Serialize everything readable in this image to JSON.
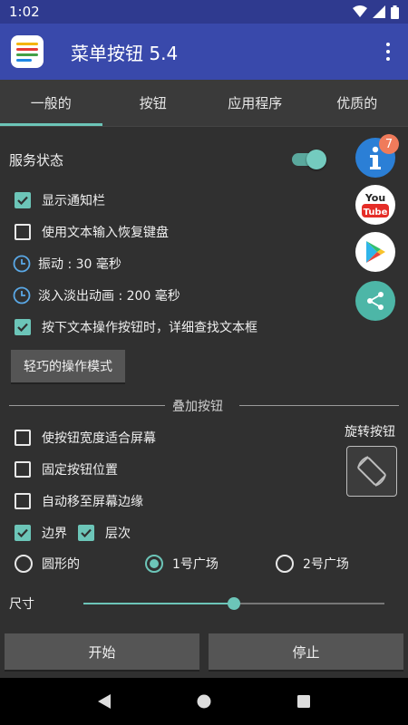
{
  "status_bar": {
    "time": "1:02"
  },
  "app_bar": {
    "title": "菜单按钮 5.4"
  },
  "tabs": [
    {
      "label": "一般的",
      "active": true
    },
    {
      "label": "按钮",
      "active": false
    },
    {
      "label": "应用程序",
      "active": false
    },
    {
      "label": "优质的",
      "active": false
    }
  ],
  "general": {
    "service_status_label": "服务状态",
    "service_enabled": true,
    "show_notification": {
      "label": "显示通知栏",
      "checked": true
    },
    "restore_keyboard": {
      "label": "使用文本输入恢复键盘",
      "checked": false
    },
    "vibration": {
      "label": "振动 : 30 毫秒"
    },
    "fade_animation": {
      "label": "淡入淡出动画 : 200 毫秒"
    },
    "find_textbox": {
      "label": "按下文本操作按钮时，详细查找文本框",
      "checked": true
    },
    "mode_button_label": "轻巧的操作模式"
  },
  "side_icons": {
    "info_badge": "7"
  },
  "overlay": {
    "section_title": "叠加按钮",
    "fit_width": {
      "label": "使按钮宽度适合屏幕",
      "checked": false
    },
    "fix_position": {
      "label": "固定按钮位置",
      "checked": false
    },
    "auto_edge": {
      "label": "自动移至屏幕边缘",
      "checked": false
    },
    "border": {
      "label": "边界",
      "checked": true
    },
    "shadow": {
      "label": "层次",
      "checked": true
    },
    "rotate_label": "旋转按钮",
    "shape_options": [
      {
        "label": "圆形的",
        "selected": false
      },
      {
        "label": "1号广场",
        "selected": true
      },
      {
        "label": "2号广场",
        "selected": false
      }
    ],
    "size_label": "尺寸",
    "size_value": 0.5
  },
  "actions": {
    "start_label": "开始",
    "stop_label": "停止"
  },
  "colors": {
    "accent": "#6cc5b8",
    "app_bar": "#3949ab",
    "status_bar": "#2f3a8f",
    "badge": "#ef7b5b"
  }
}
